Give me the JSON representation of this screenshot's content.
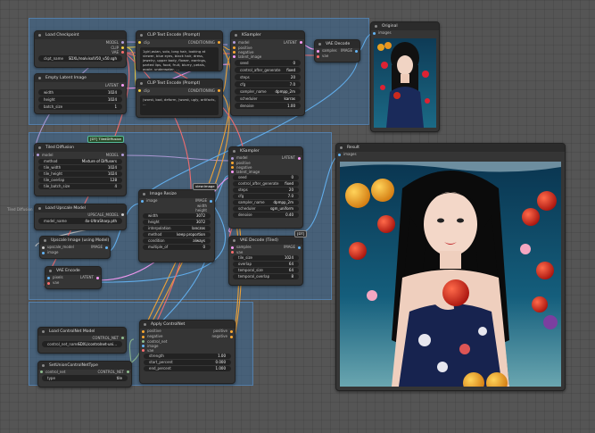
{
  "groups": {
    "g1": "",
    "g2": "",
    "g3": ""
  },
  "side_label": "Tiled Diffusion",
  "nodes": {
    "load_checkpoint": {
      "title": "Load Checkpoint",
      "outputs": [
        "MODEL",
        "CLIP",
        "VAE"
      ],
      "ckpt_label": "ckpt_name",
      "ckpt_value": "SDXL/realvisxlV50_v50.sgh"
    },
    "empty_latent": {
      "title": "Empty Latent Image",
      "out": "LATENT",
      "w1": "width",
      "v1": "1024",
      "w2": "height",
      "v2": "1024",
      "w3": "batch_size",
      "v3": "1"
    },
    "clip_pos": {
      "title": "CLIP Text Encode (Prompt)",
      "in": "clip",
      "out": "CONDITIONING",
      "text": "1girl,asian, solo, long hair, looking at viewer, blue eyes, black hair, dress, jewelry, upper body, flower, earrings, parted lips, food, fruit, blurry, petals, apple, underwater, ..."
    },
    "clip_neg": {
      "title": "CLIP Text Encode (Prompt)",
      "in": "clip",
      "out": "CONDITIONING",
      "text": "(worst, bad, deform, (worst, ugly, artifacts, ..."
    },
    "ksampler1": {
      "title": "KSampler",
      "inputs": [
        "model",
        "positive",
        "negative",
        "latent_image"
      ],
      "out": "LATENT",
      "widgets": [
        [
          "seed",
          "0"
        ],
        [
          "control_after_generate",
          "fixed"
        ],
        [
          "steps",
          "20"
        ],
        [
          "cfg",
          "7.0"
        ],
        [
          "sampler_name",
          "dpmpp_2m"
        ],
        [
          "scheduler",
          "karras"
        ],
        [
          "denoise",
          "1.00"
        ]
      ]
    },
    "vae_decode1": {
      "title": "VAE Decode",
      "inputs": [
        "samples",
        "vae"
      ],
      "out": "IMAGE"
    },
    "original": {
      "title": "Original",
      "in": "images"
    },
    "tiled_diffusion": {
      "title": "Tiled Diffusion",
      "badge": "[DT] TiledDiffusion",
      "in": "model",
      "out": "MODEL",
      "widgets": [
        [
          "method",
          "Mixture of Diffusers"
        ],
        [
          "tile_width",
          "1024"
        ],
        [
          "tile_height",
          "1024"
        ],
        [
          "tile_overlap",
          "128"
        ],
        [
          "tile_batch_size",
          "4"
        ]
      ]
    },
    "load_upscale": {
      "title": "Load Upscale Model",
      "out": "UPSCALE_MODEL",
      "w": "model_name",
      "v": "4x-UltraSharp.pth"
    },
    "upscale_with_model": {
      "title": "Upscale Image (using Model)",
      "inputs": [
        "upscale_model",
        "image"
      ],
      "out": "IMAGE"
    },
    "image_resize": {
      "title": "Image Resize",
      "badge": "view:image",
      "in": "image",
      "outs": [
        "IMAGE",
        "width",
        "height"
      ],
      "widgets": [
        [
          "width",
          "3072"
        ],
        [
          "height",
          "3072"
        ],
        [
          "interpolation",
          "lanczos"
        ],
        [
          "method",
          "keep proportion"
        ],
        [
          "condition",
          "always"
        ],
        [
          "multiple_of",
          "0"
        ]
      ]
    },
    "vae_encode": {
      "title": "VAE Encode",
      "inputs": [
        "pixels",
        "vae"
      ],
      "out": "LATENT"
    },
    "ksampler2": {
      "title": "KSampler",
      "inputs": [
        "model",
        "positive",
        "negative",
        "latent_image"
      ],
      "out": "LATENT",
      "widgets": [
        [
          "seed",
          "0"
        ],
        [
          "control_after_generate",
          "fixed"
        ],
        [
          "steps",
          "20"
        ],
        [
          "cfg",
          "7.0"
        ],
        [
          "sampler_name",
          "dpmpp_2m"
        ],
        [
          "scheduler",
          "sgm_uniform"
        ],
        [
          "denoise",
          "0.40"
        ]
      ]
    },
    "vae_decode_tiled": {
      "title": "VAE Decode (Tiled)",
      "badge": "[DT]",
      "inputs": [
        "samples",
        "vae"
      ],
      "out": "IMAGE",
      "widgets": [
        [
          "tile_size",
          "1024"
        ],
        [
          "overlap",
          "64"
        ],
        [
          "temporal_size",
          "64"
        ],
        [
          "temporal_overlap",
          "8"
        ]
      ]
    },
    "result": {
      "title": "Result",
      "in": "images"
    },
    "load_controlnet": {
      "title": "Load ControlNet Model",
      "out": "CONTROL_NET",
      "w": "control_net_name",
      "v": "SDXL/controlnet-uni..."
    },
    "apply_controlnet": {
      "title": "Apply ControlNet",
      "inputs": [
        "positive",
        "negative",
        "control_net",
        "image",
        "vae"
      ],
      "outs": [
        "positive",
        "negative"
      ],
      "widgets": [
        [
          "strength",
          "1.00"
        ],
        [
          "start_percent",
          "0.000"
        ],
        [
          "end_percent",
          "1.000"
        ]
      ]
    },
    "set_union": {
      "title": "SetUnionControlNetType",
      "in": "control_net",
      "out": "CONTROL_NET",
      "w": "type",
      "v": "tile"
    }
  },
  "colors": {
    "model": "#b39ddb",
    "clip": "#f5d142",
    "vae": "#ff6e6e",
    "latent": "#ff9cf9",
    "cond": "#ffa931",
    "image": "#64b5f6"
  }
}
